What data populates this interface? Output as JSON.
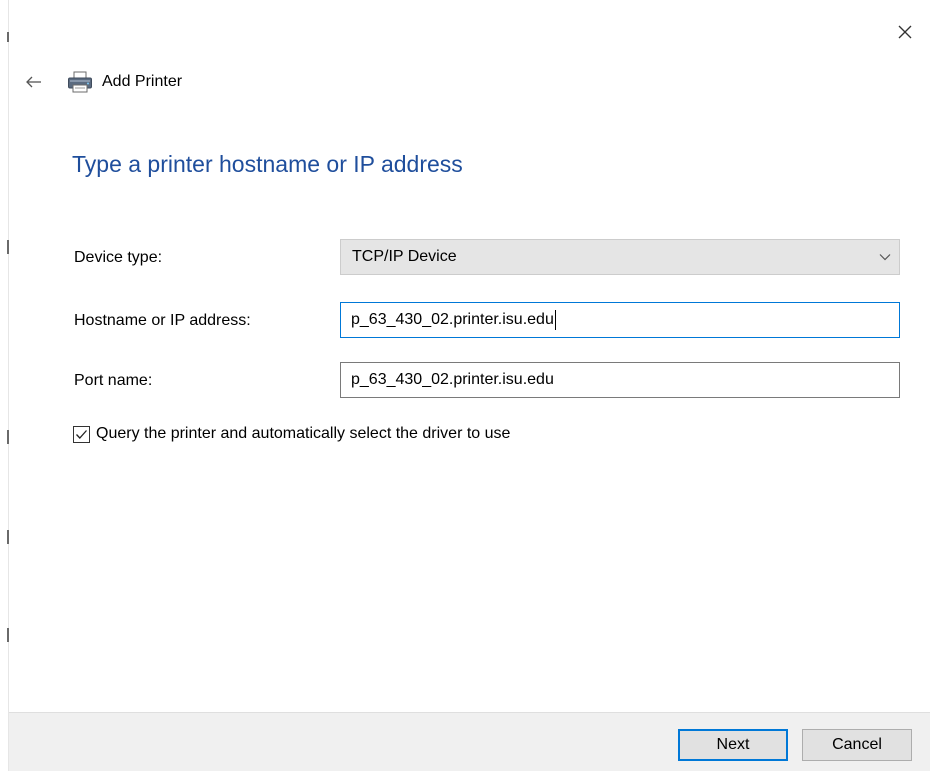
{
  "header": {
    "title": "Add Printer",
    "back_icon": "back-arrow-icon",
    "printer_icon": "printer-icon",
    "close_icon": "close-icon"
  },
  "main": {
    "heading": "Type a printer hostname or IP address",
    "heading_color": "#1f4e9c"
  },
  "form": {
    "device_type": {
      "label": "Device type:",
      "value": "TCP/IP Device"
    },
    "hostname": {
      "label": "Hostname or IP address:",
      "value": "p_63_430_02.printer.isu.edu"
    },
    "port": {
      "label": "Port name:",
      "value": "p_63_430_02.printer.isu.edu"
    },
    "query_checkbox": {
      "label": "Query the printer and automatically select the driver to use",
      "checked": true
    }
  },
  "footer": {
    "next_label": "Next",
    "cancel_label": "Cancel",
    "accent_color": "#0078d7"
  }
}
